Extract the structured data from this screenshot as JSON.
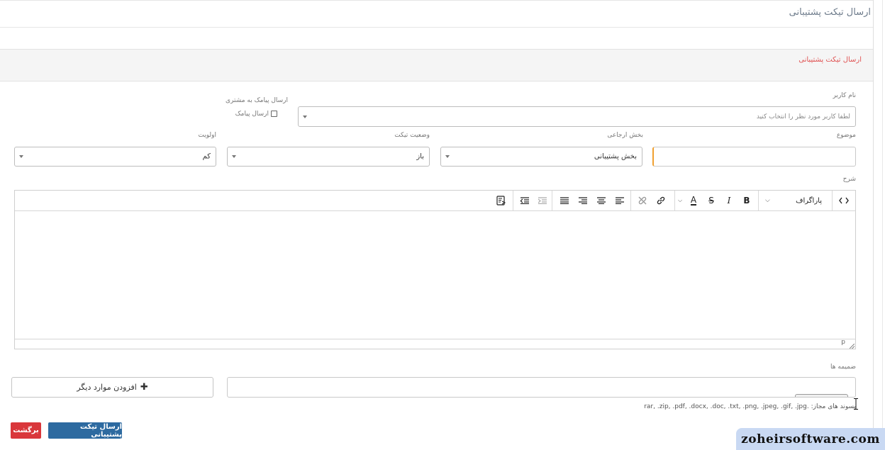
{
  "page": {
    "title": "ارسال تیکت پشتیبانی"
  },
  "panel": {
    "title": "ارسال تیکت پشتیبانی"
  },
  "form": {
    "username": {
      "label": "نام کاربر",
      "placeholder": "لطفا کاربر مورد نظر را انتخاب کنید"
    },
    "sms": {
      "label": "ارسال پیامک به مشتری",
      "checkbox_label": "ارسال پیامک",
      "checked": false
    },
    "subject": {
      "label": "موضوع",
      "value": ""
    },
    "department": {
      "label": "بخش ارجاعی",
      "value": "بخش پشتیبانی"
    },
    "status": {
      "label": "وضعیت تیکت",
      "value": "باز"
    },
    "priority": {
      "label": "اولویت",
      "value": "کم"
    },
    "description": {
      "label": "شرح",
      "toolbar": {
        "format_value": "پاراگراف",
        "buttons": [
          "code-view",
          "format-select",
          "bold",
          "italic",
          "strikethrough",
          "font-color",
          "link",
          "unlink",
          "align-left",
          "align-center",
          "align-right",
          "justify",
          "indent",
          "outdent",
          "paste-from-word"
        ]
      },
      "status_path": "p"
    },
    "attachments": {
      "label": "ضمیمه ها",
      "add_more_label": "افزودن موارد دیگر",
      "allowed_text": "پسوند های مجاز: .rar, .zip, .pdf, .docx, .doc, .txt, .png, .jpeg, .gif, .jpg"
    }
  },
  "actions": {
    "send_label": "ارسال تیکت پشتیبانی",
    "back_label": "برگشت"
  },
  "watermark": {
    "text": "zoheirsoftware.com"
  },
  "colors": {
    "primary": "#2d6aa0",
    "danger": "#d9373b",
    "panel_title": "#e05353",
    "subject_focus": "#f0a030",
    "watermark_bg": "#c9d9f3"
  }
}
